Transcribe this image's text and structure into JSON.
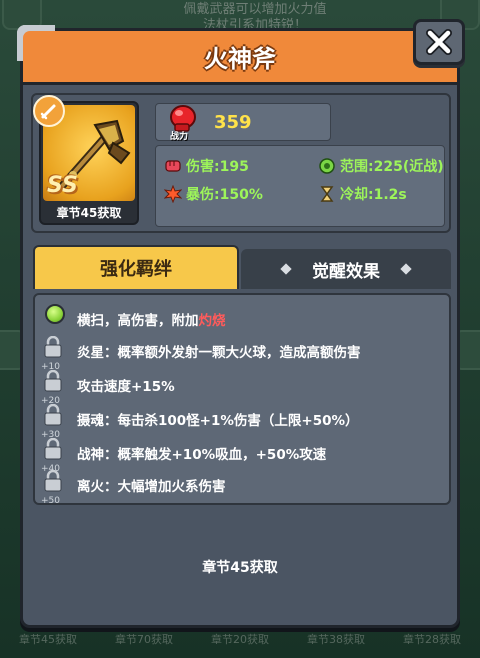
{
  "background": {
    "top_text_line1": "佩戴武器可以增加火力值",
    "top_text_line2": "法杖引系加特锐！",
    "bottom_row": [
      "章节45获取",
      "章节70获取",
      "章节20获取",
      "章节38获取",
      "章节28获取"
    ]
  },
  "popup": {
    "title": "火神斧",
    "close_icon": "close-x-icon",
    "weapon": {
      "rarity": "SS",
      "source": "章节45获取"
    },
    "power": {
      "tag": "战力",
      "value": "359"
    },
    "stats": [
      {
        "icon": "fist-icon",
        "label": "伤害:195"
      },
      {
        "icon": "gear-range-icon",
        "label": "范围:225(近战)"
      },
      {
        "icon": "crit-burst-icon",
        "label": "暴伤:150%"
      },
      {
        "icon": "hourglass-icon",
        "label": "冷却:1.2s"
      }
    ],
    "tabs": {
      "active": "强化羁绊",
      "inactive": "觉醒效果"
    },
    "skills": [
      {
        "lvl": "",
        "text": "横扫，高伤害，附加",
        "highlight": "灼烧",
        "unlocked": true
      },
      {
        "lvl": "+10",
        "text": "炎星：概率额外发射一颗大火球，造成高额伤害",
        "highlight": "",
        "unlocked": false
      },
      {
        "lvl": "+20",
        "text": "攻击速度+15%",
        "highlight": "",
        "unlocked": false
      },
      {
        "lvl": "+30",
        "text": "摄魂：每击杀100怪+1%伤害（上限+50%）",
        "highlight": "",
        "unlocked": false
      },
      {
        "lvl": "+40",
        "text": "战神：概率触发+10%吸血，+50%攻速",
        "highlight": "",
        "unlocked": false
      },
      {
        "lvl": "+50",
        "text": "离火：大幅增加火系伤害",
        "highlight": "",
        "unlocked": false
      }
    ],
    "footer_source": "章节45获取"
  },
  "colors": {
    "title_bar": "#f0893a",
    "tab_active": "#f7c84a",
    "stat_text": "#9df55a",
    "power_value": "#ffe24a",
    "highlight": "#ff5b5b"
  }
}
